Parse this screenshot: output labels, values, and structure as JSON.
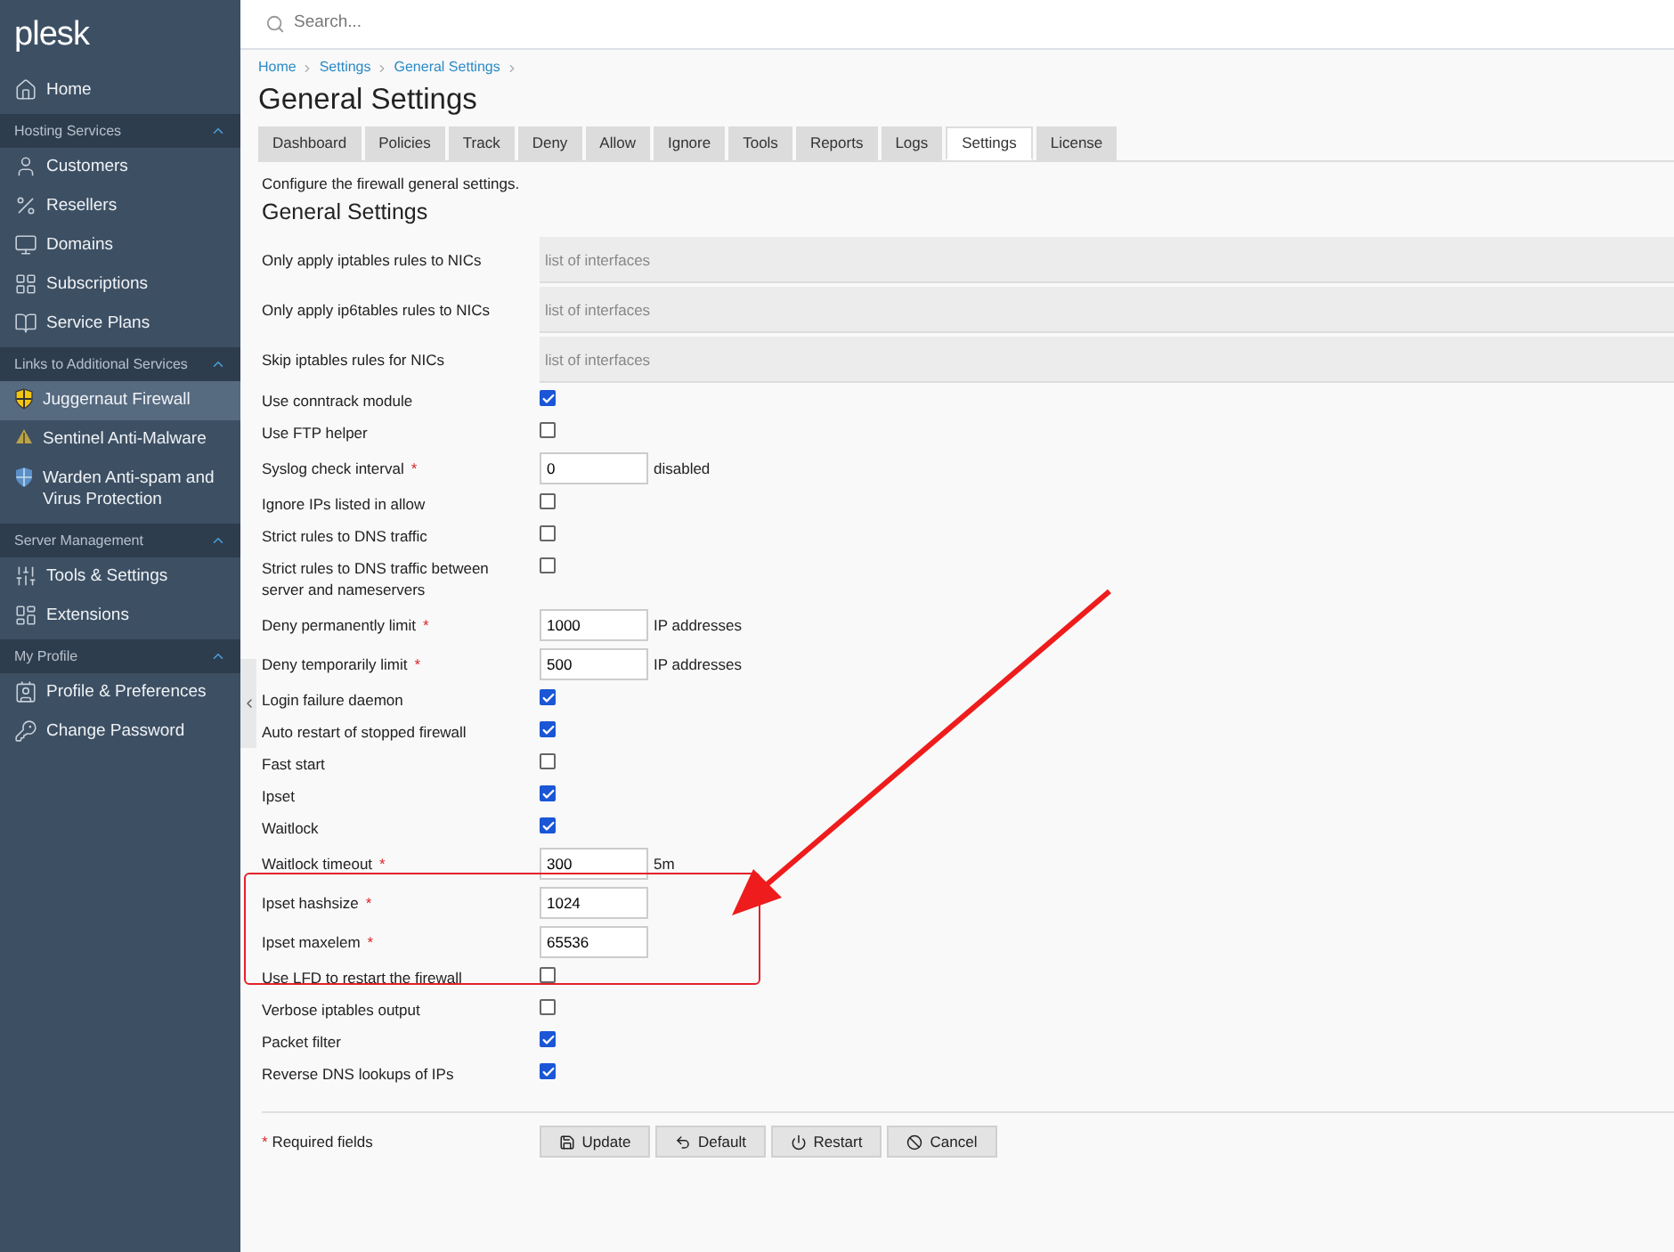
{
  "logo": "plesk",
  "sidebar": [
    {
      "kind": "item",
      "label": "Home",
      "selected": false
    },
    {
      "kind": "group",
      "label": "Hosting Services",
      "expanded": true
    },
    {
      "kind": "item",
      "label": "Customers",
      "selected": false
    },
    {
      "kind": "item",
      "label": "Resellers",
      "selected": false
    },
    {
      "kind": "item",
      "label": "Domains",
      "selected": false
    },
    {
      "kind": "item",
      "label": "Subscriptions",
      "selected": false
    },
    {
      "kind": "item",
      "label": "Service Plans",
      "selected": false
    },
    {
      "kind": "group",
      "label": "Links to Additional Services",
      "expanded": true
    },
    {
      "kind": "item",
      "label": "Juggernaut Firewall",
      "selected": true
    },
    {
      "kind": "item",
      "label": "Sentinel Anti-Malware",
      "selected": false
    },
    {
      "kind": "item",
      "label": "Warden Anti-spam and Virus Protection",
      "selected": false
    },
    {
      "kind": "group",
      "label": "Server Management",
      "expanded": true
    },
    {
      "kind": "item",
      "label": "Tools & Settings",
      "selected": false
    },
    {
      "kind": "item",
      "label": "Extensions",
      "selected": false
    },
    {
      "kind": "group",
      "label": "My Profile",
      "expanded": true
    },
    {
      "kind": "item",
      "label": "Profile & Preferences",
      "selected": false
    },
    {
      "kind": "item",
      "label": "Change Password",
      "selected": false
    }
  ],
  "search": {
    "placeholder": "Search..."
  },
  "breadcrumbs": [
    "Home",
    "Settings",
    "General Settings"
  ],
  "title": "General Settings",
  "tabs": [
    {
      "label": "Dashboard",
      "selected": false
    },
    {
      "label": "Policies",
      "selected": false
    },
    {
      "label": "Track",
      "selected": false
    },
    {
      "label": "Deny",
      "selected": false
    },
    {
      "label": "Allow",
      "selected": false
    },
    {
      "label": "Ignore",
      "selected": false
    },
    {
      "label": "Tools",
      "selected": false
    },
    {
      "label": "Reports",
      "selected": false
    },
    {
      "label": "Logs",
      "selected": false
    },
    {
      "label": "Settings",
      "selected": true
    },
    {
      "label": "License",
      "selected": false
    }
  ],
  "description": "Configure the firewall general settings.",
  "section_title": "General Settings",
  "rows": [
    {
      "kind": "list",
      "label": "Only apply iptables rules to NICs",
      "required": false,
      "placeholder": "list of interfaces"
    },
    {
      "kind": "list",
      "label": "Only apply ip6tables rules to NICs",
      "required": false,
      "placeholder": "list of interfaces"
    },
    {
      "kind": "list",
      "label": "Skip iptables rules for NICs",
      "required": false,
      "placeholder": "list of interfaces"
    },
    {
      "kind": "checkbox",
      "label": "Use conntrack module",
      "required": false,
      "checked": true
    },
    {
      "kind": "checkbox",
      "label": "Use FTP helper",
      "required": false,
      "checked": false
    },
    {
      "kind": "number",
      "label": "Syslog check interval",
      "required": true,
      "value": "0",
      "unit": "disabled"
    },
    {
      "kind": "checkbox",
      "label": "Ignore IPs listed in allow",
      "required": false,
      "checked": false
    },
    {
      "kind": "checkbox",
      "label": "Strict rules to DNS traffic",
      "required": false,
      "checked": false
    },
    {
      "kind": "checkbox",
      "label": "Strict rules to DNS traffic between server and nameservers",
      "required": false,
      "checked": false
    },
    {
      "kind": "number",
      "label": "Deny permanently limit",
      "required": true,
      "value": "1000",
      "unit": "IP addresses"
    },
    {
      "kind": "number",
      "label": "Deny temporarily limit",
      "required": true,
      "value": "500",
      "unit": "IP addresses"
    },
    {
      "kind": "checkbox",
      "label": "Login failure daemon",
      "required": false,
      "checked": true
    },
    {
      "kind": "checkbox",
      "label": "Auto restart of stopped firewall",
      "required": false,
      "checked": true
    },
    {
      "kind": "checkbox",
      "label": "Fast start",
      "required": false,
      "checked": false
    },
    {
      "kind": "checkbox",
      "label": "Ipset",
      "required": false,
      "checked": true
    },
    {
      "kind": "checkbox",
      "label": "Waitlock",
      "required": false,
      "checked": true
    },
    {
      "kind": "number",
      "label": "Waitlock timeout",
      "required": true,
      "value": "300",
      "unit": "5m"
    },
    {
      "kind": "number",
      "label": "Ipset hashsize",
      "required": true,
      "value": "1024"
    },
    {
      "kind": "number",
      "label": "Ipset maxelem",
      "required": true,
      "value": "65536"
    },
    {
      "kind": "checkbox",
      "label": "Use LFD to restart the firewall",
      "required": false,
      "checked": false
    },
    {
      "kind": "checkbox",
      "label": "Verbose iptables output",
      "required": false,
      "checked": false
    },
    {
      "kind": "checkbox",
      "label": "Packet filter",
      "required": false,
      "checked": true
    },
    {
      "kind": "checkbox",
      "label": "Reverse DNS lookups of IPs",
      "required": false,
      "checked": true
    }
  ],
  "required_mark": "*",
  "required_note": "Required fields",
  "buttons": [
    "Update",
    "Default",
    "Restart",
    "Cancel"
  ]
}
